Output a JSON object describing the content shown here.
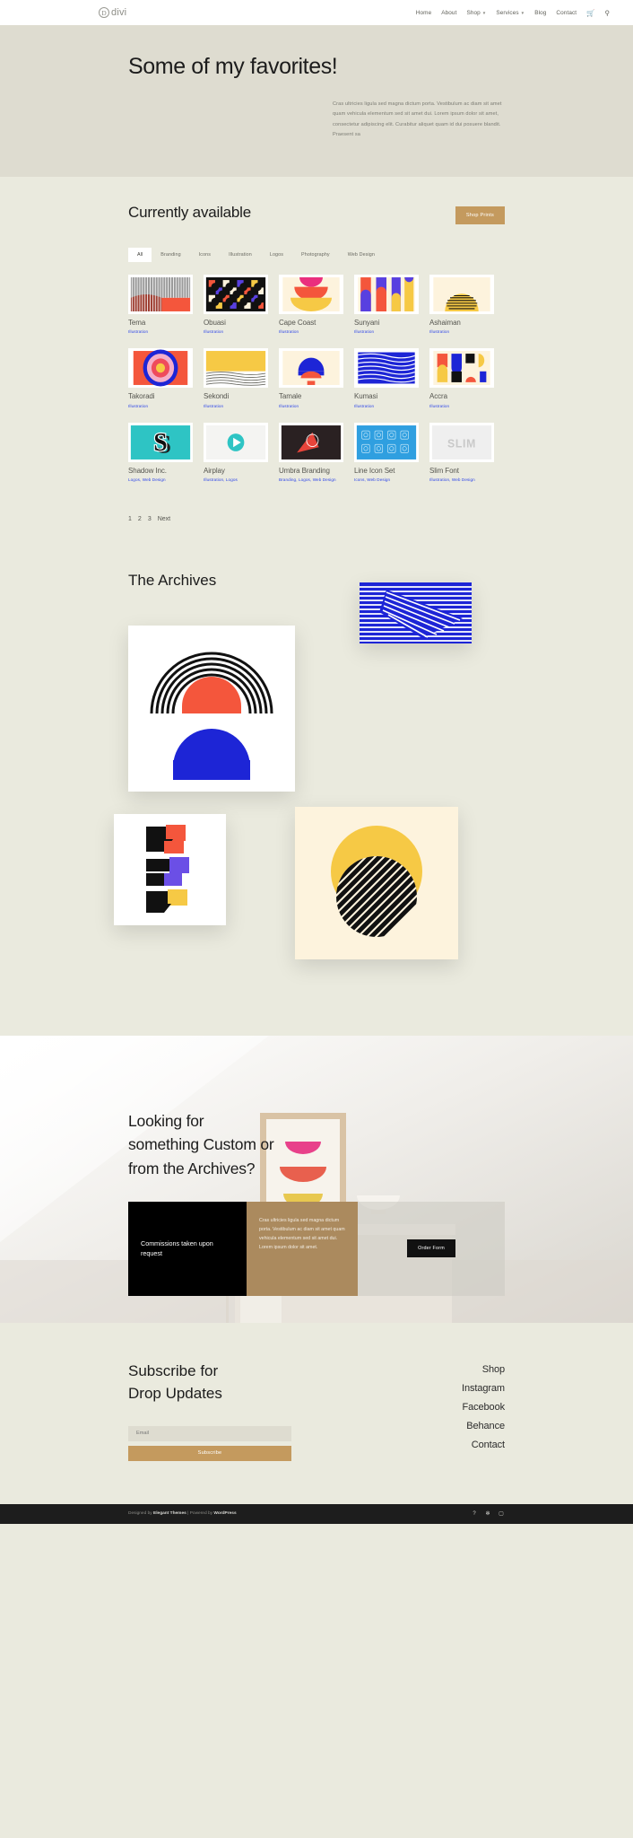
{
  "header": {
    "logo_letter": "D",
    "logo_text": "divi",
    "nav": [
      {
        "label": "Home",
        "has_caret": false
      },
      {
        "label": "About",
        "has_caret": false
      },
      {
        "label": "Shop",
        "has_caret": true
      },
      {
        "label": "Services",
        "has_caret": true
      },
      {
        "label": "Blog",
        "has_caret": false
      },
      {
        "label": "Contact",
        "has_caret": false
      }
    ],
    "cart_icon": "shopping-cart-icon",
    "search_icon": "search-icon"
  },
  "hero": {
    "title": "Some of my favorites!",
    "paragraph": "Cras ultricies ligula sed magna dictum porta. Vestibulum ac diam sit amet quam vehicula elementum sed sit amet dui. Lorem ipsum dolor sit amet, consectetur adipiscing elit. Curabitur aliquet quam id dui posuere blandit. Praesent sa"
  },
  "available": {
    "title": "Currently available",
    "shop_button": "Shop Prints",
    "filters": [
      "All",
      "Branding",
      "Icons",
      "Illustration",
      "Logos",
      "Photography",
      "Web Design"
    ],
    "active_filter": "All",
    "items": [
      {
        "title": "Tema",
        "categories": "Illustration"
      },
      {
        "title": "Obuasi",
        "categories": "Illustration"
      },
      {
        "title": "Cape Coast",
        "categories": "Illustration"
      },
      {
        "title": "Sunyani",
        "categories": "Illustration"
      },
      {
        "title": "Ashaiman",
        "categories": "Illustration"
      },
      {
        "title": "Takoradi",
        "categories": "Illustration"
      },
      {
        "title": "Sekondi",
        "categories": "Illustration"
      },
      {
        "title": "Tamale",
        "categories": "Illustration"
      },
      {
        "title": "Kumasi",
        "categories": "Illustration"
      },
      {
        "title": "Accra",
        "categories": "Illustration"
      },
      {
        "title": "Shadow Inc.",
        "categories": "Logos, Web Design"
      },
      {
        "title": "Airplay",
        "categories": "Illustration, Logos"
      },
      {
        "title": "Umbra Branding",
        "categories": "Branding, Logos, Web Design"
      },
      {
        "title": "Line Icon Set",
        "categories": "Icons, Web Design"
      },
      {
        "title": "Slim Font",
        "categories": "Illustration, Web Design"
      }
    ],
    "pagination": [
      "1",
      "2",
      "3",
      "Next"
    ]
  },
  "archives": {
    "title": "The Archives"
  },
  "cta": {
    "title_line1": "Looking for",
    "title_line2": "something Custom or",
    "title_line3": "from the Archives?",
    "black_box_text": "Commissions taken upon request",
    "tan_box_text": "Cras ultricies ligula sed magna dictum porta. Vestibulum ac diam sit amet quam vehicula elementum sed sit amet dui. Lorem ipsum dolor sit amet.",
    "order_button": "Order Form"
  },
  "subscribe": {
    "title_line1": "Subscribe for",
    "title_line2": "Drop Updates",
    "email_placeholder": "Email",
    "button_label": "Subscribe",
    "links": [
      "Shop",
      "Instagram",
      "Facebook",
      "Behance",
      "Contact"
    ]
  },
  "footer": {
    "prefix": "Designed by ",
    "brand1": "Elegant Themes",
    "middle": " | Powered by ",
    "brand2": "WordPress",
    "socials": [
      "facebook-icon",
      "twitter-icon",
      "instagram-icon"
    ]
  },
  "colors": {
    "accent_gold": "#c49a5e",
    "category_blue": "#2e46e8",
    "hero_bg": "#dedcd0",
    "page_bg": "#eaeade",
    "footer_bg": "#1d1d1d"
  }
}
